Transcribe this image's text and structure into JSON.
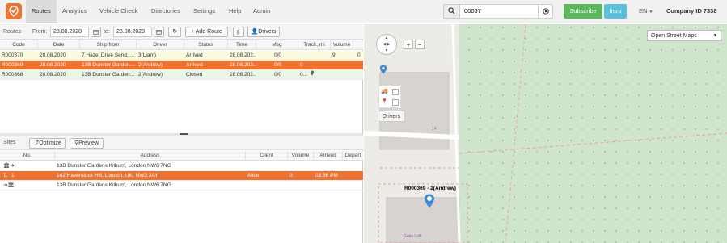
{
  "nav": {
    "items": [
      "Routes",
      "Analytics",
      "Vehicle Check",
      "Directories",
      "Settings",
      "Help",
      "Admin"
    ],
    "active": "Routes"
  },
  "search": {
    "value": "00037"
  },
  "header": {
    "subscribe": "Subscribe",
    "intro": "Intro",
    "language": "EN",
    "company": "Company ID 7338"
  },
  "routes": {
    "title": "Routes",
    "from_label": "From:",
    "from_date": "28.08.2020",
    "to_label": "to:",
    "to_date": "28.08.2020",
    "add_route": "Add Route",
    "drivers": "Drivers",
    "columns": [
      "Code",
      "Date",
      "Ship from",
      "Driver",
      "Status",
      "Time",
      "Msg",
      "Track, mi",
      "Volume"
    ],
    "rows": [
      {
        "code": "R000370",
        "date": "28.08.2020",
        "ship_from": "7 Hazel Drive Send, ...",
        "driver": "3(Liam)",
        "status": "Arrived",
        "time": "28.08.202...",
        "msg": "0/0",
        "track": "",
        "volume": "9",
        "extra": "0"
      },
      {
        "code": "R000369",
        "date": "28.08.2020",
        "ship_from": "13B Dunster Garden...",
        "driver": "2(Andrew)",
        "status": "Arrived",
        "time": "28.08.202...",
        "msg": "0/0",
        "track": "0",
        "volume": "",
        "extra": ""
      },
      {
        "code": "R000368",
        "date": "28.08.2020",
        "ship_from": "13B Dunster Garden...",
        "driver": "2(Andrew)",
        "status": "Closed",
        "time": "28.08.202...",
        "msg": "0/0",
        "track": "0.1",
        "volume": "",
        "extra": ""
      }
    ]
  },
  "sites": {
    "title": "Sites",
    "optimize": "Optimize",
    "preview": "Preview",
    "columns": [
      "No.",
      "Address",
      "Client",
      "Volume",
      "Arrived",
      "Depart"
    ],
    "rows": [
      {
        "no": "",
        "address": "13B Dunster Gardens Kilburn, London NW6 7NG",
        "client": "",
        "volume": "",
        "arrived": ""
      },
      {
        "no": "1",
        "address": "142 Haverstock Hill, London, UK, NW3 2AY",
        "client": "Alice",
        "volume": "0",
        "arrived": "03:56 PM"
      },
      {
        "no": "",
        "address": "13B Dunster Gardens Kilburn, London NW6 7NG",
        "client": "",
        "volume": "",
        "arrived": ""
      }
    ]
  },
  "map": {
    "layer": "Open Street Maps",
    "drivers_label": "Drivers",
    "marker_label": "R000369 - 2(Andrew)",
    "zoom_in": "+",
    "zoom_out": "−",
    "building_number": "14",
    "place_label": "Geko Loft"
  },
  "colors": {
    "accent": "#f0722f",
    "selected_row": "#f0722f",
    "arrived_row": "#fbfbe0",
    "closed_row": "#e9f6e6",
    "subscribe": "#5cb85c",
    "intro": "#5bc0de",
    "map_park": "#cfe6cc",
    "map_building": "#d6d3d0"
  }
}
